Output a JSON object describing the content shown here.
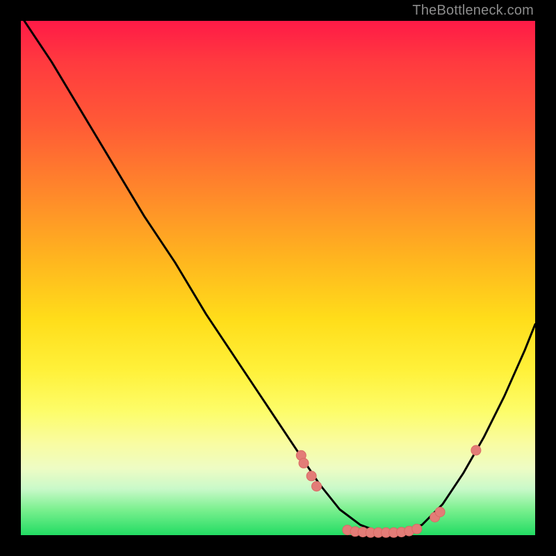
{
  "watermark": "TheBottleneck.com",
  "colors": {
    "curve_stroke": "#000000",
    "marker_fill": "#e37c77",
    "marker_stroke": "#d96a65"
  },
  "chart_data": {
    "type": "line",
    "title": "",
    "xlabel": "",
    "ylabel": "",
    "xlim": [
      0,
      100
    ],
    "ylim": [
      0,
      100
    ],
    "series": [
      {
        "name": "curve",
        "x": [
          0,
          6,
          12,
          18,
          24,
          30,
          36,
          42,
          48,
          54,
          58,
          62,
          66,
          70,
          74,
          78,
          82,
          86,
          90,
          94,
          98,
          100
        ],
        "y": [
          101,
          92,
          82,
          72,
          62,
          53,
          43,
          34,
          25,
          16,
          10,
          5,
          2,
          0.5,
          0.5,
          2,
          6,
          12,
          19,
          27,
          36,
          41
        ]
      }
    ],
    "markers": [
      {
        "x": 54.5,
        "y": 15.5
      },
      {
        "x": 55.0,
        "y": 14.0
      },
      {
        "x": 56.5,
        "y": 11.5
      },
      {
        "x": 57.5,
        "y": 9.5
      },
      {
        "x": 63.5,
        "y": 1.0
      },
      {
        "x": 65.0,
        "y": 0.7
      },
      {
        "x": 66.5,
        "y": 0.6
      },
      {
        "x": 68.0,
        "y": 0.5
      },
      {
        "x": 69.5,
        "y": 0.5
      },
      {
        "x": 71.0,
        "y": 0.5
      },
      {
        "x": 72.5,
        "y": 0.5
      },
      {
        "x": 74.0,
        "y": 0.6
      },
      {
        "x": 75.5,
        "y": 0.8
      },
      {
        "x": 77.0,
        "y": 1.2
      },
      {
        "x": 80.5,
        "y": 3.5
      },
      {
        "x": 81.5,
        "y": 4.5
      },
      {
        "x": 88.5,
        "y": 16.5
      }
    ]
  }
}
